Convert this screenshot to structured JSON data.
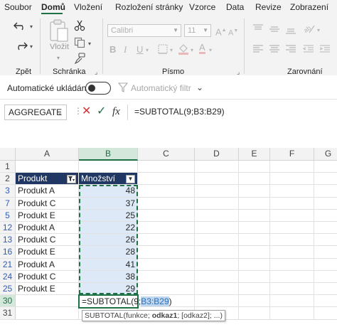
{
  "ribbon": {
    "tabs": [
      "Soubor",
      "Domů",
      "Vložení",
      "Rozložení stránky",
      "Vzorce",
      "Data",
      "Revize",
      "Zobrazení"
    ],
    "active_tab": "Domů",
    "groups": {
      "undo": "Zpět",
      "clipboard": "Schránka",
      "font": "Písmo",
      "alignment": "Zarovnání"
    },
    "paste_label": "Vložit",
    "font_name": "Calibri",
    "font_size": "11",
    "accent_color": "#1e7145"
  },
  "autosave": {
    "label": "Automatické ukládání",
    "state": "off",
    "autofilter_label": "Automatický filtr"
  },
  "formula_bar": {
    "name_box": "AGGREGATE",
    "fx_label": "fx",
    "formula": "=SUBTOTAL(9;B3:B29)"
  },
  "sheet": {
    "columns": [
      "A",
      "B",
      "C",
      "D",
      "E",
      "F",
      "G"
    ],
    "header_fill": "#203764",
    "table_headers": [
      "Produkt",
      "Množství"
    ],
    "rows": [
      {
        "num": "1",
        "a": "",
        "b": ""
      },
      {
        "num": "2",
        "a": "Produkt",
        "b": "Množství"
      },
      {
        "num": "3",
        "a": "Produkt A",
        "b": "48"
      },
      {
        "num": "7",
        "a": "Produkt C",
        "b": "37"
      },
      {
        "num": "5",
        "a": "Produkt E",
        "b": "25"
      },
      {
        "num": "12",
        "a": "Produkt A",
        "b": "22"
      },
      {
        "num": "13",
        "a": "Produkt C",
        "b": "26"
      },
      {
        "num": "16",
        "a": "Produkt E",
        "b": "28"
      },
      {
        "num": "21",
        "a": "Produkt A",
        "b": "41"
      },
      {
        "num": "24",
        "a": "Produkt C",
        "b": "38"
      },
      {
        "num": "25",
        "a": "Produkt E",
        "b": "29"
      },
      {
        "num": "30",
        "a": "",
        "b": ""
      },
      {
        "num": "31",
        "a": "",
        "b": ""
      }
    ],
    "edit_prefix": "=SUBTOTAL(9;",
    "edit_ref": "B3:B29",
    "edit_suffix": ")",
    "tooltip": {
      "func": "SUBTOTAL(funkce; ",
      "bold_arg": "odkaz1",
      "rest": "; [odkaz2]; ...)"
    }
  }
}
